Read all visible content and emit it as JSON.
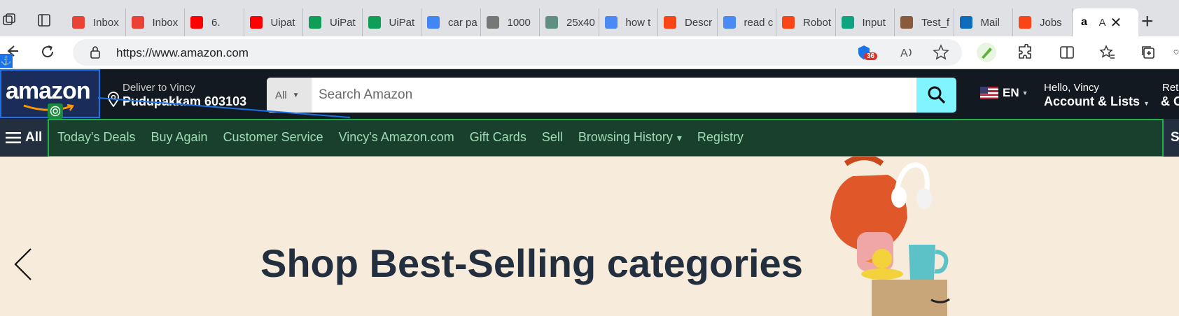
{
  "browser": {
    "tabs": [
      {
        "label": "Inbox",
        "icon": "gmail-icon",
        "color": "#ea4335"
      },
      {
        "label": "Inbox",
        "icon": "gmail-icon",
        "color": "#ea4335"
      },
      {
        "label": "6.",
        "icon": "youtube-icon",
        "color": "#ff0000"
      },
      {
        "label": "Uipat",
        "icon": "youtube-icon",
        "color": "#ff0000"
      },
      {
        "label": "UiPat",
        "icon": "sheets-icon",
        "color": "#0f9d58"
      },
      {
        "label": "UiPat",
        "icon": "sheets-icon",
        "color": "#0f9d58"
      },
      {
        "label": "car pa",
        "icon": "google-icon",
        "color": "#4285f4"
      },
      {
        "label": "1000",
        "icon": "page-icon",
        "color": "#777777"
      },
      {
        "label": "25x40",
        "icon": "wave-icon",
        "color": "#5e8f80"
      },
      {
        "label": "how t",
        "icon": "search-icon",
        "color": "#4a8af4"
      },
      {
        "label": "Descr",
        "icon": "uipath-icon",
        "color": "#fa4616"
      },
      {
        "label": "read c",
        "icon": "search-icon",
        "color": "#4a8af4"
      },
      {
        "label": "Robot",
        "icon": "uipath-icon",
        "color": "#fa4616"
      },
      {
        "label": "Input",
        "icon": "chatgpt-icon",
        "color": "#10a37f"
      },
      {
        "label": "Test_f",
        "icon": "avatar-icon",
        "color": "#8a5a3c"
      },
      {
        "label": "Mail",
        "icon": "outlook-icon",
        "color": "#0f6cbd"
      },
      {
        "label": "Jobs",
        "icon": "uipath-icon",
        "color": "#fa4616"
      }
    ],
    "active_tab": {
      "label": "A",
      "icon": "amazon-icon"
    },
    "url": "https://www.amazon.com",
    "extension_badge": "36"
  },
  "amazon": {
    "logo": "amazon",
    "deliver_to": "Deliver to Vincy",
    "location": "Pudupakkam 603103",
    "search_category": "All",
    "search_placeholder": "Search Amazon",
    "language": "EN",
    "greeting": "Hello, Vincy",
    "account": "Account & Lists",
    "returns_small": "Retu",
    "returns_big": "& O",
    "menu_label": "All",
    "nav_links": [
      "Today's Deals",
      "Buy Again",
      "Customer Service",
      "Vincy's Amazon.com",
      "Gift Cards",
      "Sell",
      "Browsing History",
      "Registry"
    ],
    "nav_right": "S",
    "hero_title": "Shop Best-Selling categories"
  },
  "colors": {
    "amazon_dark": "#131921",
    "amazon_nav": "#232f3e",
    "search_button": "#80f5ff",
    "hero_bg": "#f7ecdb",
    "selection_blue": "#1a73e8",
    "selection_green": "#22b04a"
  }
}
